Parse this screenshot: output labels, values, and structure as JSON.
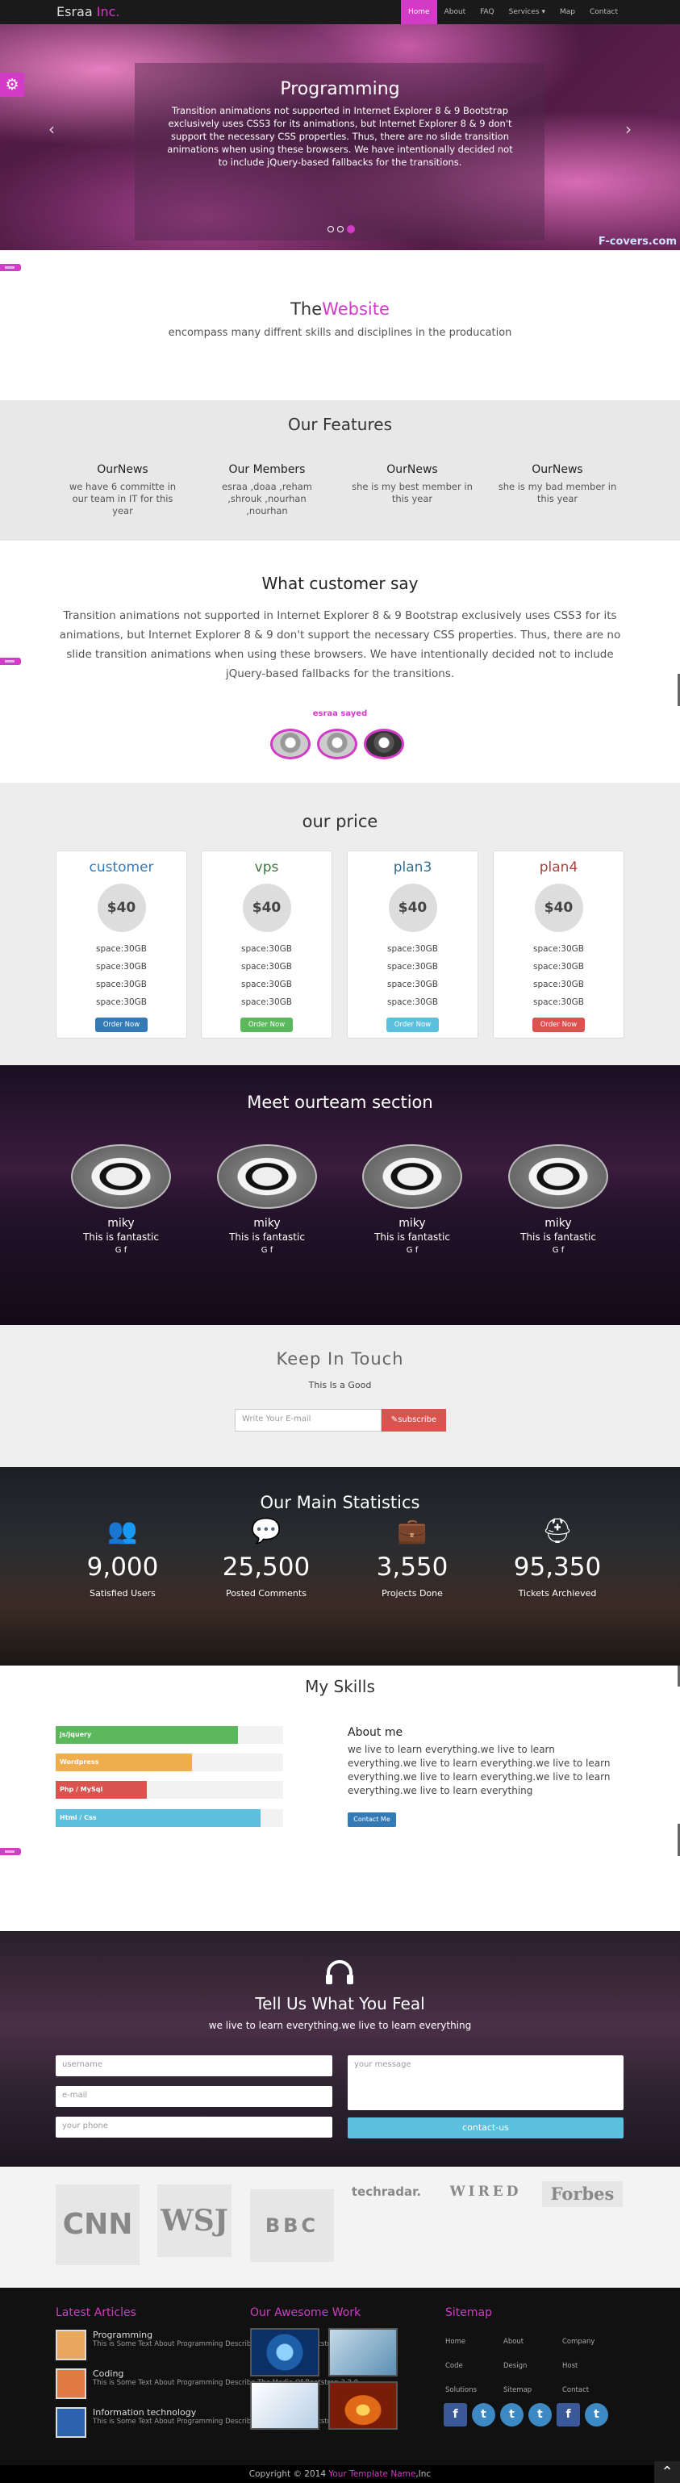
{
  "nav": {
    "brand": "Esraa",
    "brand_accent": "Inc.",
    "items": [
      "Home",
      "About",
      "FAQ",
      "Services ▾",
      "Map",
      "Contact"
    ]
  },
  "slider": {
    "title": "Programming",
    "text": "Transition animations not supported in Internet Explorer 8 & 9 Bootstrap exclusively uses CSS3 for its animations, but Internet Explorer 8 & 9 don't support the necessary CSS properties. Thus, there are no slide transition animations when using these browsers. We have intentionally decided not to include jQuery-based fallbacks for the transitions.",
    "watermark": "F-covers.com"
  },
  "website": {
    "title_plain": "The",
    "title_accent": "Website",
    "subtitle": "encompass many diffrent skills and disciplines in the producation"
  },
  "features": {
    "title": "Our Features",
    "items": [
      {
        "title": "OurNews",
        "text": "we have 6 committe in our team in IT for this year"
      },
      {
        "title": "Our Members",
        "text": "esraa ,doaa ,reham ,shrouk ,nourhan ,nourhan"
      },
      {
        "title": "OurNews",
        "text": "she is my best member in this year"
      },
      {
        "title": "OurNews",
        "text": "she is my bad member in this year"
      }
    ]
  },
  "testimonial": {
    "title": "What customer say",
    "text": "Transition animations not supported in Internet Explorer 8 & 9 Bootstrap exclusively uses CSS3 for its animations, but Internet Explorer 8 & 9 don't support the necessary CSS properties. Thus, there are no slide transition animations when using these browsers. We have intentionally decided not to include jQuery-based fallbacks for the transitions.",
    "name": "esraa sayed"
  },
  "pricing": {
    "title": "our price",
    "plans": [
      {
        "name": "customer",
        "price": "$40",
        "features": [
          "space:30GB",
          "space:30GB",
          "space:30GB",
          "space:30GB"
        ],
        "button": "Order Now",
        "color": "#337ab7",
        "btn_color": "#337ab7"
      },
      {
        "name": "vps",
        "price": "$40",
        "features": [
          "space:30GB",
          "space:30GB",
          "space:30GB",
          "space:30GB"
        ],
        "button": "Order Now",
        "color": "#3c763d",
        "btn_color": "#5cb85c"
      },
      {
        "name": "plan3",
        "price": "$40",
        "features": [
          "space:30GB",
          "space:30GB",
          "space:30GB",
          "space:30GB"
        ],
        "button": "Order Now",
        "color": "#31708f",
        "btn_color": "#5bc0de"
      },
      {
        "name": "plan4",
        "price": "$40",
        "features": [
          "space:30GB",
          "space:30GB",
          "space:30GB",
          "space:30GB"
        ],
        "button": "Order Now",
        "color": "#a94442",
        "btn_color": "#d9534f"
      }
    ]
  },
  "team": {
    "title": "Meet ourteam section",
    "members": [
      {
        "name": "miky",
        "role": "This is fantastic",
        "social": "G f"
      },
      {
        "name": "miky",
        "role": "This is fantastic",
        "social": "G f"
      },
      {
        "name": "miky",
        "role": "This is fantastic",
        "social": "G f"
      },
      {
        "name": "miky",
        "role": "This is fantastic",
        "social": "G f"
      }
    ]
  },
  "newsletter": {
    "title": "Keep In Touch",
    "subtitle": "This Is a Good",
    "placeholder": "Write Your E-mail",
    "button": "subscribe"
  },
  "stats": {
    "title": "Our Main Statistics",
    "items": [
      {
        "icon": "users-icon",
        "glyph": "👥",
        "value": "9,000",
        "label": "Satisfied Users"
      },
      {
        "icon": "comments-icon",
        "glyph": "💬",
        "value": "25,500",
        "label": "Posted Comments"
      },
      {
        "icon": "briefcase-icon",
        "glyph": "💼",
        "value": "3,550",
        "label": "Projects Done"
      },
      {
        "icon": "lifebuoy-icon",
        "glyph": "⛑",
        "value": "95,350",
        "label": "Tickets Archieved"
      }
    ]
  },
  "skills": {
    "title": "My Skills",
    "bars": [
      {
        "label": "js/jquery",
        "percent": 80,
        "color": "#5cb85c"
      },
      {
        "label": "Wordpress",
        "percent": 60,
        "color": "#f0ad4e"
      },
      {
        "label": "Php / MySql",
        "percent": 40,
        "color": "#d9534f"
      },
      {
        "label": "Html / Css",
        "percent": 90,
        "color": "#5bc0de"
      }
    ],
    "about_title": "About me",
    "about_text": "we live to learn everything.we live to learn everything.we live to learn everything.we live to learn everything.we live to learn everything.we live to learn everything.we live to learn everything",
    "about_button": "Contact Me"
  },
  "contact": {
    "title": "Tell Us What You Feal",
    "subtitle": "we live to learn everything.we live to learn everything",
    "username_placeholder": "username",
    "email_placeholder": "e-mail",
    "phone_placeholder": "your phone",
    "message_placeholder": "your message",
    "button": "contact-us"
  },
  "logos": [
    "CNN",
    "WSJ",
    "BBC",
    "techradar.",
    "WIRED",
    "Forbes"
  ],
  "footer": {
    "articles_title": "Latest Articles",
    "articles": [
      {
        "title": "Programming",
        "text": "This is Some Text About Programming Describe The Media Of Bootstrap 3.2.0"
      },
      {
        "title": "Coding",
        "text": "This is Some Text About Programming Describe The Media Of Bootstrap 3.2.0"
      },
      {
        "title": "Information technology",
        "text": "This is Some Text About Programming Describe The Media Of Bootstrap 3.2.0"
      }
    ],
    "work_title": "Our Awesome Work",
    "sitemap_title": "Sitemap",
    "sitemap": [
      "Home",
      "About",
      "Company",
      "Code",
      "Design",
      "Host",
      "Solutions",
      "Sitemap",
      "Contact"
    ],
    "copyright_pre": "Copyright © 2014",
    "copyright_name": "Your Template Name",
    "copyright_post": ",Inc"
  }
}
